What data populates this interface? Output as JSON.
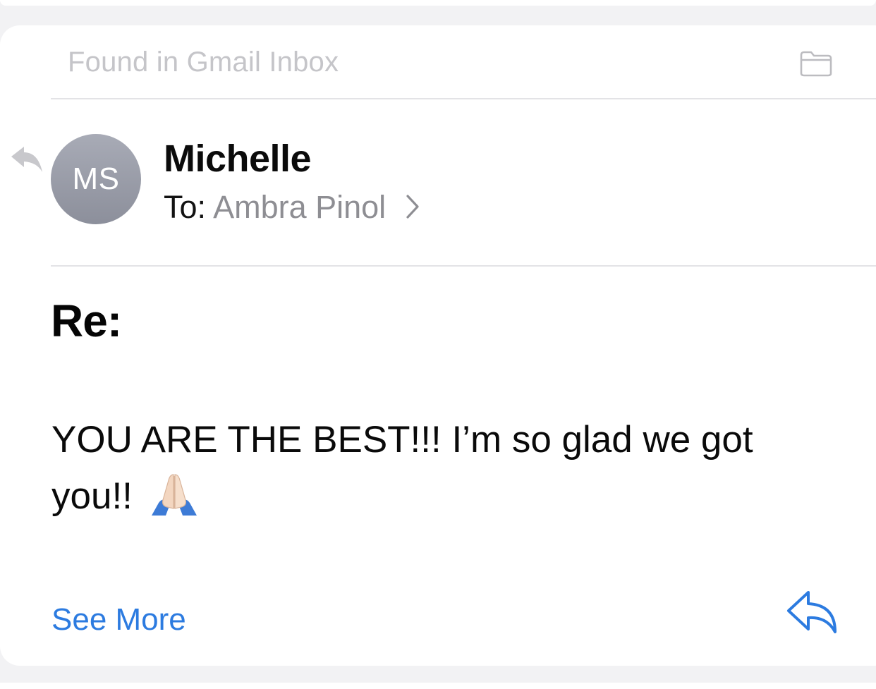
{
  "source": {
    "label": "Found in Gmail Inbox",
    "icon": "folder-icon"
  },
  "message": {
    "sender_name": "Michelle",
    "avatar_initials": "MS",
    "avatar_color": "#9a9da8",
    "to_label": "To:",
    "recipient": "Ambra Pinol",
    "subject": "Re:",
    "body": "YOU ARE THE BEST!!! I’m so glad we got you!!",
    "body_emoji": "folded-hands-icon"
  },
  "actions": {
    "see_more_label": "See More",
    "reply_icon": "reply-icon"
  },
  "colors": {
    "accent": "#2c7be0",
    "muted_text": "#8e8e93",
    "source_text": "#c5c5c9"
  }
}
